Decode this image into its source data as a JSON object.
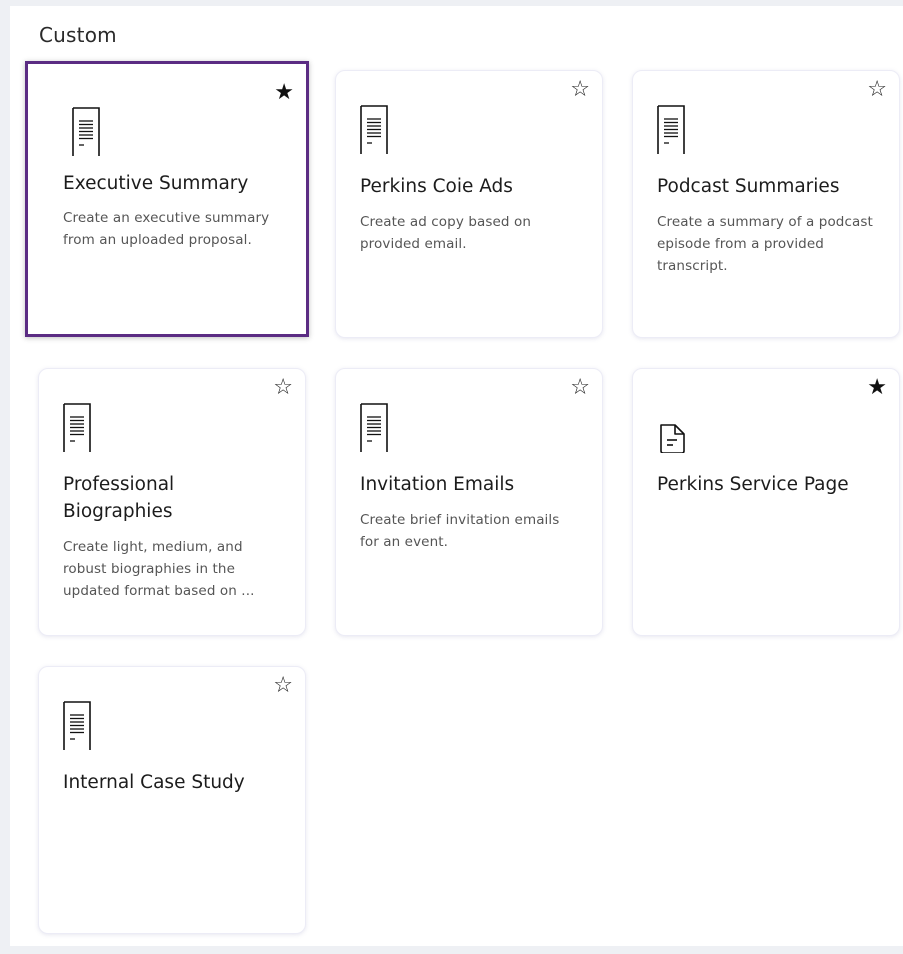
{
  "section": {
    "title": "Custom"
  },
  "cards": [
    {
      "title": "Executive Summary",
      "description": "Create an executive summary from an uploaded proposal.",
      "icon": "document-lines-icon",
      "favorite": true
    },
    {
      "title": "Perkins Coie Ads",
      "description": "Create ad copy based on provided email.",
      "icon": "document-lines-icon",
      "favorite": false
    },
    {
      "title": "Podcast Summaries",
      "description": "Create a summary of a podcast episode from a provided transcript.",
      "icon": "document-lines-icon",
      "favorite": false
    },
    {
      "title": "Professional Biographies",
      "description": "Create light, medium, and robust biographies in the updated format based on ...",
      "icon": "document-lines-icon",
      "favorite": false
    },
    {
      "title": "Invitation Emails",
      "description": "Create brief invitation emails for an event.",
      "icon": "document-lines-icon",
      "favorite": false
    },
    {
      "title": "Perkins Service Page",
      "description": "",
      "icon": "document-icon",
      "favorite": true
    },
    {
      "title": "Internal Case Study",
      "description": "",
      "icon": "document-lines-icon",
      "favorite": false
    }
  ],
  "glyphs": {
    "star_filled": "★",
    "star_empty": "☆"
  }
}
